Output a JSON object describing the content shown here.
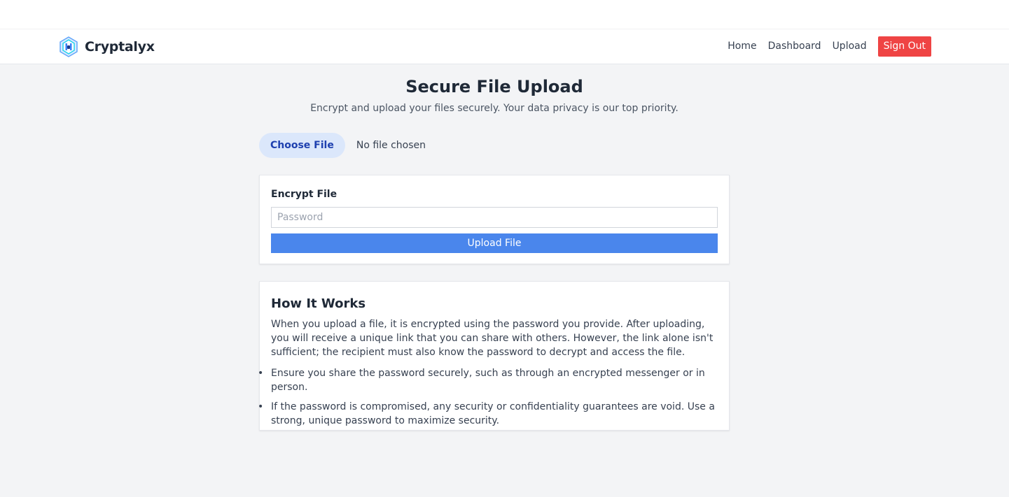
{
  "brand": {
    "name": "Cryptalyx",
    "logo_icon": "shield-logo-icon"
  },
  "nav": {
    "home": "Home",
    "dashboard": "Dashboard",
    "upload": "Upload",
    "sign_out": "Sign Out"
  },
  "page": {
    "title": "Secure File Upload",
    "subtitle": "Encrypt and upload your files securely. Your data privacy is our top priority."
  },
  "file_picker": {
    "button_label": "Choose File",
    "status": "No file chosen"
  },
  "encrypt": {
    "label": "Encrypt File",
    "password_placeholder": "Password",
    "upload_label": "Upload File"
  },
  "how": {
    "title": "How It Works",
    "body": "When you upload a file, it is encrypted using the password you provide. After uploading, you will receive a unique link that you can share with others. However, the link alone isn't sufficient; the recipient must also know the password to decrypt and access the file.",
    "points": [
      "Ensure you share the password securely, such as through an encrypted messenger or in person.",
      "If the password is compromised, any security or confidentiality guarantees are void. Use a strong, unique password to maximize security."
    ]
  },
  "colors": {
    "sign_out_bg": "#ef4444",
    "upload_bg": "#4a86ec",
    "choose_bg": "#dbe7fb",
    "choose_text": "#1e40af",
    "page_bg": "#f3f4f6"
  }
}
